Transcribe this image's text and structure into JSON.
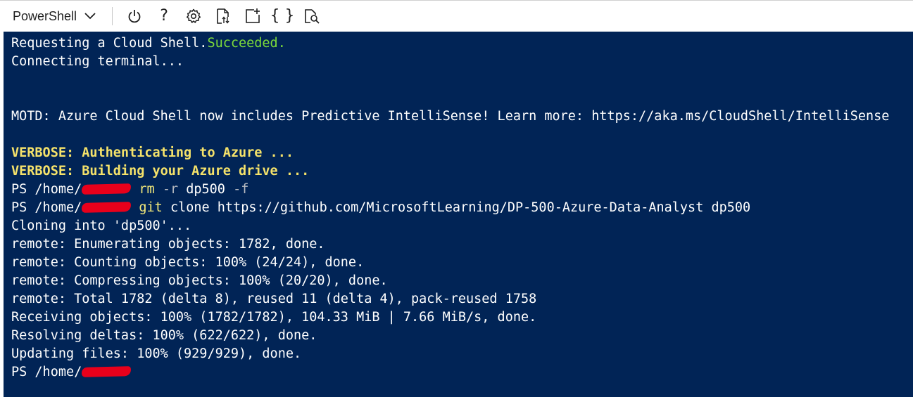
{
  "toolbar": {
    "shell_label": "PowerShell",
    "buttons": [
      {
        "name": "restart-icon"
      },
      {
        "name": "help-icon"
      },
      {
        "name": "settings-icon"
      },
      {
        "name": "upload-download-icon"
      },
      {
        "name": "new-session-icon"
      },
      {
        "name": "editor-icon"
      },
      {
        "name": "web-preview-icon"
      }
    ]
  },
  "terminal": {
    "line1_text": "Requesting a Cloud Shell.",
    "line1_status": "Succeeded.",
    "line2": "Connecting terminal...",
    "motd": "MOTD: Azure Cloud Shell now includes Predictive IntelliSense! Learn more: https://aka.ms/CloudShell/IntelliSense",
    "verbose1": "VERBOSE: Authenticating to Azure ...",
    "verbose2": "VERBOSE: Building your Azure drive ...",
    "prompt": "PS /home/",
    "cmd1_name": "rm",
    "cmd1_param": "-r",
    "cmd1_args": "dp500",
    "cmd1_flag": "-f",
    "cmd2_name": "git",
    "cmd2_args": "clone https://github.com/MicrosoftLearning/DP-500-Azure-Data-Analyst dp500",
    "output": [
      "Cloning into 'dp500'...",
      "remote: Enumerating objects: 1782, done.",
      "remote: Counting objects: 100% (24/24), done.",
      "remote: Compressing objects: 100% (20/20), done.",
      "remote: Total 1782 (delta 8), reused 11 (delta 4), pack-reused 1758",
      "Receiving objects: 100% (1782/1782), 104.33 MiB | 7.66 MiB/s, done.",
      "Resolving deltas: 100% (622/622), done.",
      "Updating files: 100% (929/929), done."
    ]
  },
  "colors": {
    "terminal_bg": "#012456",
    "success": "#7ddb3a",
    "verbose": "#f5e26a",
    "redaction": "#e8001b"
  }
}
